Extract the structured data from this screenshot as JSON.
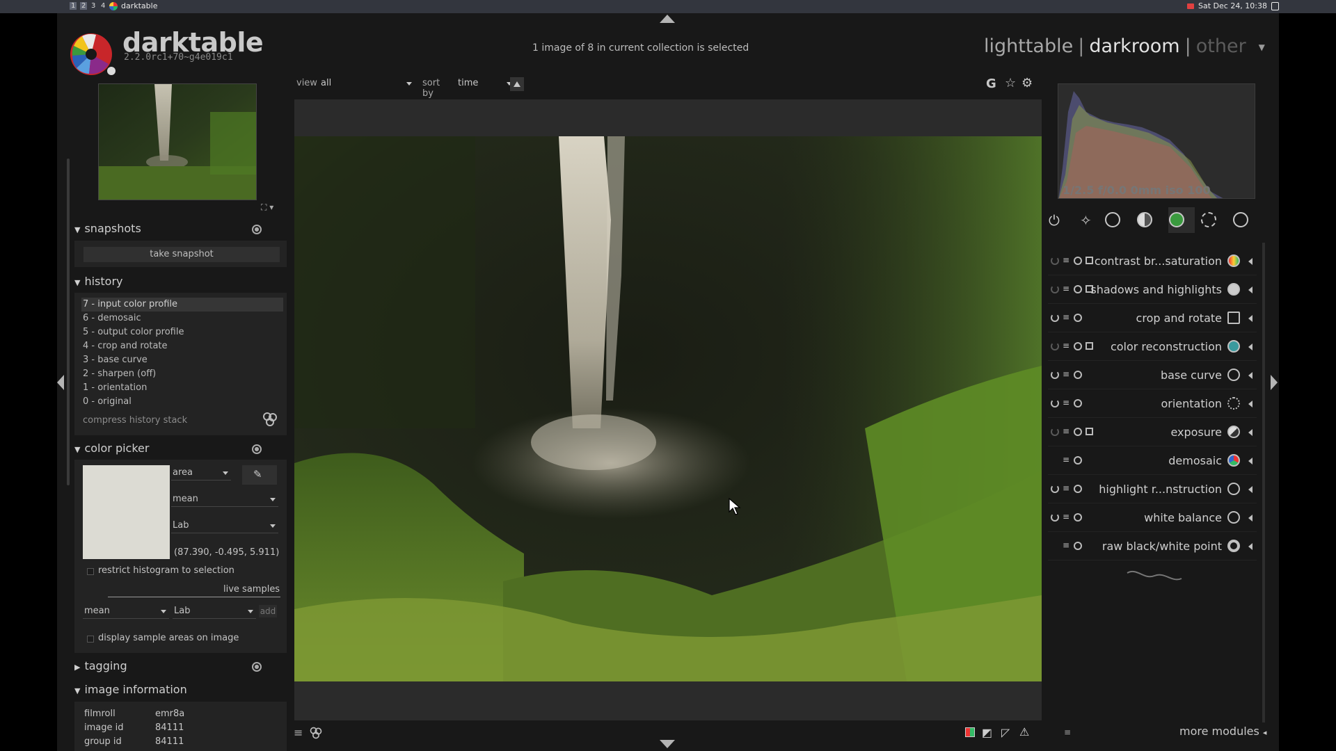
{
  "os_bar": {
    "workspaces": [
      "1",
      "2",
      "3",
      "4"
    ],
    "app_name": "darktable",
    "clock": "Sat Dec 24, 10:38"
  },
  "header": {
    "app_title": "darktable",
    "version": "2.2.0rc1+70~g4e019c1",
    "status": "1 image of 8 in current collection is selected",
    "views": {
      "lighttable": "lighttable",
      "darkroom": "darkroom",
      "other": "other"
    }
  },
  "toolbar": {
    "view_label": "view",
    "view_value": "all",
    "sort_label": "sort by",
    "sort_value": "time"
  },
  "header_icons": {
    "grouping": "G",
    "overlays": "☆",
    "preferences": "⚙"
  },
  "left": {
    "snapshots": {
      "title": "snapshots",
      "take_snapshot": "take snapshot"
    },
    "history": {
      "title": "history",
      "items": [
        "7 - input color profile",
        "6 - demosaic",
        "5 - output color profile",
        "4 - crop and rotate",
        "3 - base curve",
        "2 - sharpen (off)",
        "1 - orientation",
        "0 - original"
      ],
      "selected_index": 0,
      "compress": "compress history stack"
    },
    "color_picker": {
      "title": "color picker",
      "mode": "area",
      "statistic": "mean",
      "colorspace": "Lab",
      "values": "(87.390, -0.495, 5.911)",
      "restrict_label": "restrict histogram to selection",
      "live_samples": "live samples",
      "sample_statistic": "mean",
      "sample_colorspace": "Lab",
      "add": "add",
      "display_samples_label": "display sample areas on image",
      "swatch_color": "#dcdbd3"
    },
    "tagging": {
      "title": "tagging"
    },
    "image_information": {
      "title": "image information",
      "rows": [
        {
          "label": "filmroll",
          "value": "emr8a"
        },
        {
          "label": "image id",
          "value": "84111"
        },
        {
          "label": "group id",
          "value": "84111"
        }
      ]
    }
  },
  "right": {
    "histogram": {
      "exif": "1/2.5 f/0.0 0mm iso 100"
    },
    "modules": [
      {
        "name": "contrast br...saturation",
        "power": false,
        "multi": true
      },
      {
        "name": "shadows and highlights",
        "power": false,
        "multi": true
      },
      {
        "name": "crop and rotate",
        "power": true,
        "multi": false
      },
      {
        "name": "color reconstruction",
        "power": false,
        "multi": true
      },
      {
        "name": "base curve",
        "power": true,
        "multi": false
      },
      {
        "name": "orientation",
        "power": true,
        "multi": false
      },
      {
        "name": "exposure",
        "power": false,
        "multi": true
      },
      {
        "name": "demosaic",
        "power": null,
        "multi": false
      },
      {
        "name": "highlight r...nstruction",
        "power": true,
        "multi": false
      },
      {
        "name": "white balance",
        "power": true,
        "multi": false
      },
      {
        "name": "raw black/white point",
        "power": null,
        "multi": false
      }
    ],
    "more_modules": "more modules"
  },
  "colors": {
    "background": "#181818",
    "panel": "#232323",
    "center": "#2b2b2b",
    "text": "#c8c8c8"
  }
}
